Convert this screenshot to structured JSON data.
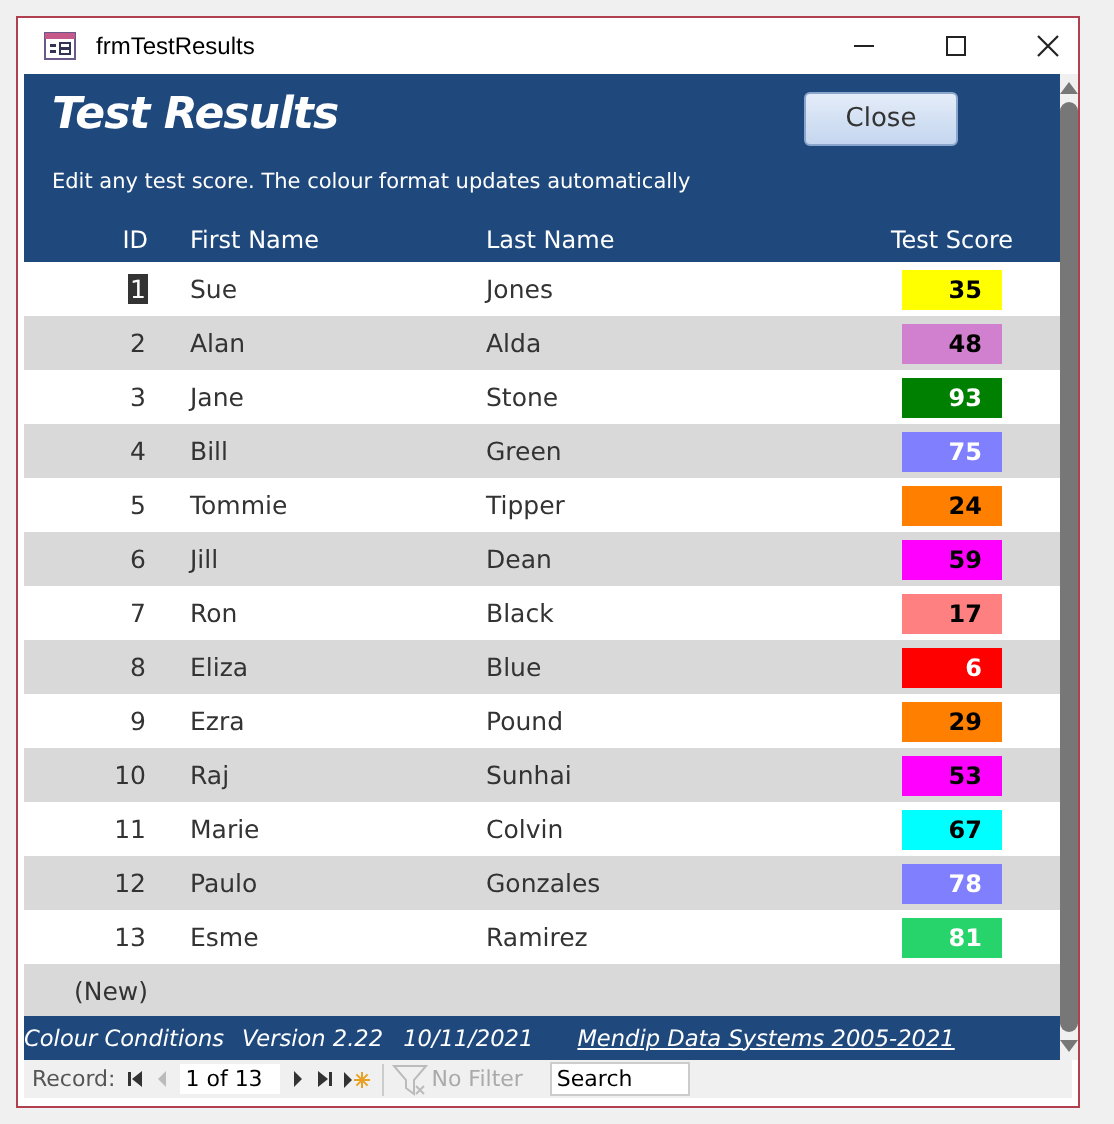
{
  "window": {
    "title": "frmTestResults"
  },
  "header": {
    "title": "Test Results",
    "close_button": "Close",
    "instructions": "Edit any test score. The colour format updates automatically"
  },
  "columns": [
    "ID",
    "First Name",
    "Last Name",
    "Test Score"
  ],
  "rows": [
    {
      "id": "1",
      "first": "Sue",
      "last": "Jones",
      "score": "35",
      "color": "#ffff00",
      "kind": "dark",
      "selected": true
    },
    {
      "id": "2",
      "first": "Alan",
      "last": "Alda",
      "score": "48",
      "color": "#d17fcf",
      "kind": "dark",
      "selected": false
    },
    {
      "id": "3",
      "first": "Jane",
      "last": "Stone",
      "score": "93",
      "color": "#008000",
      "kind": "light",
      "selected": false
    },
    {
      "id": "4",
      "first": "Bill",
      "last": "Green",
      "score": "75",
      "color": "#8080ff",
      "kind": "light",
      "selected": false
    },
    {
      "id": "5",
      "first": "Tommie",
      "last": "Tipper",
      "score": "24",
      "color": "#ff8000",
      "kind": "dark",
      "selected": false
    },
    {
      "id": "6",
      "first": "Jill",
      "last": "Dean",
      "score": "59",
      "color": "#ff00ff",
      "kind": "dark",
      "selected": false
    },
    {
      "id": "7",
      "first": "Ron",
      "last": "Black",
      "score": "17",
      "color": "#ff8080",
      "kind": "dark",
      "selected": false
    },
    {
      "id": "8",
      "first": "Eliza",
      "last": "Blue",
      "score": "6",
      "color": "#ff0000",
      "kind": "light",
      "selected": false
    },
    {
      "id": "9",
      "first": "Ezra",
      "last": "Pound",
      "score": "29",
      "color": "#ff8000",
      "kind": "dark",
      "selected": false
    },
    {
      "id": "10",
      "first": "Raj",
      "last": "Sunhai",
      "score": "53",
      "color": "#ff00ff",
      "kind": "dark",
      "selected": false
    },
    {
      "id": "11",
      "first": "Marie",
      "last": "Colvin",
      "score": "67",
      "color": "#00ffff",
      "kind": "dark",
      "selected": false
    },
    {
      "id": "12",
      "first": "Paulo",
      "last": "Gonzales",
      "score": "78",
      "color": "#8080ff",
      "kind": "light",
      "selected": false
    },
    {
      "id": "13",
      "first": "Esme",
      "last": "Ramirez",
      "score": "81",
      "color": "#27d36b",
      "kind": "light",
      "selected": false
    }
  ],
  "new_row": "(New)",
  "footer": {
    "app": "Colour Conditions",
    "version": "Version 2.22",
    "date": "10/11/2021",
    "link": "Mendip Data Systems 2005-2021"
  },
  "navigation": {
    "label": "Record:",
    "position": "1 of 13",
    "filter": "No Filter",
    "search": {
      "placeholder": "Search"
    }
  }
}
